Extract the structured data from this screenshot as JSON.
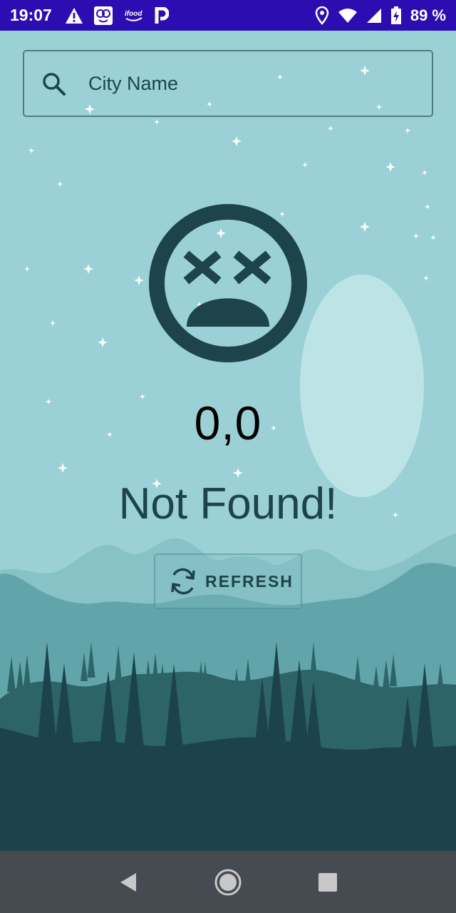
{
  "status_bar": {
    "time": "19:07",
    "battery": "89 %",
    "left_icons": [
      "warning-icon",
      "app-notification-icon",
      "ifood-icon",
      "parking-icon"
    ],
    "right_icons": [
      "location-icon",
      "wifi-icon",
      "signal-icon",
      "battery-charging-icon"
    ],
    "ifood_text": "ifood"
  },
  "search": {
    "placeholder": "City Name",
    "value": ""
  },
  "weather": {
    "coordinates": "0,0",
    "message": "Not Found!",
    "status_icon": "dead-face-icon"
  },
  "refresh": {
    "label": "REFRESH",
    "icon": "refresh-icon"
  },
  "nav": {
    "icons": [
      "back-icon",
      "home-icon",
      "recents-icon"
    ]
  },
  "colors": {
    "status_bar": "#2c0db1",
    "sky": "#9bd1d6",
    "dark": "#1d434b",
    "moon": "#bce4e6",
    "nav_bar": "#464b52"
  }
}
